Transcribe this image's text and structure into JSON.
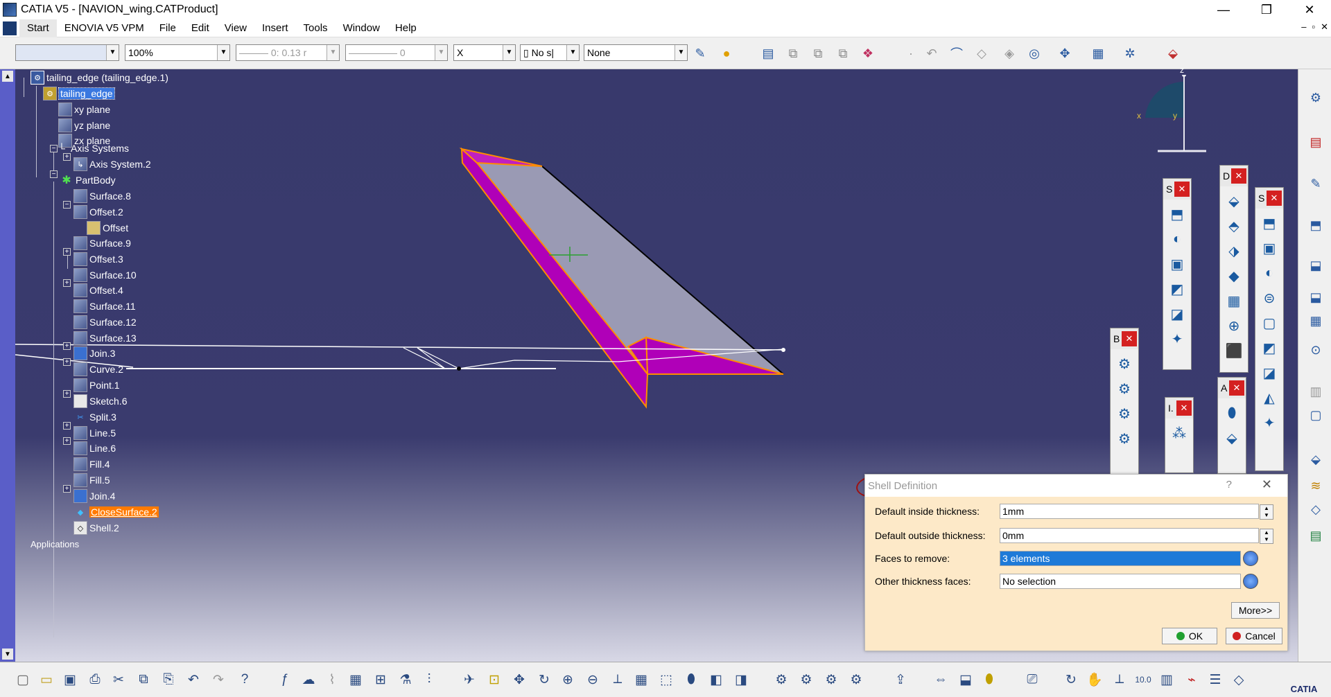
{
  "window": {
    "title": "CATIA V5 - [NAVION_wing.CATProduct]",
    "min": "—",
    "restore": "❐",
    "close": "✕",
    "mdi": [
      "‒",
      "▫",
      "✕"
    ]
  },
  "menu": [
    "Start",
    "ENOVIA V5 VPM",
    "File",
    "Edit",
    "View",
    "Insert",
    "Tools",
    "Window",
    "Help"
  ],
  "toolbar": {
    "color_combo": "",
    "zoom": "100%",
    "linetype": "0: 0.13 r",
    "lineweight": "0",
    "layer_sym": "X",
    "layer": "No s|",
    "style": "None"
  },
  "tree": {
    "root": "tailing_edge (tailing_edge.1)",
    "part": "tailing_edge",
    "nodes": [
      "xy plane",
      "yz plane",
      "zx plane",
      "Axis Systems",
      "Axis System.2",
      "PartBody",
      "Surface.8",
      "Offset.2",
      "Offset",
      "Surface.9",
      "Offset.3",
      "Surface.10",
      "Offset.4",
      "Surface.11",
      "Surface.12",
      "Surface.13",
      "Join.3",
      "Curve.2",
      "Point.1",
      "Sketch.6",
      "Split.3",
      "Line.5",
      "Line.6",
      "Fill.4",
      "Fill.5",
      "Join.4",
      "CloseSurface.2",
      "Shell.2"
    ],
    "applications": "Applications"
  },
  "compass": {
    "z": "z",
    "x": "x",
    "y": "y"
  },
  "floating_toolbars": {
    "t1": "S",
    "t2": "D",
    "t3": "S",
    "t4": "B",
    "t5": "I.",
    "t6": "A"
  },
  "dialog": {
    "title": "Shell Definition",
    "help": "?",
    "close": "✕",
    "inside_label": "Default inside thickness:",
    "inside_value": "1mm",
    "outside_label": "Default outside thickness:",
    "outside_value": "0mm",
    "faces_label": "Faces to remove:",
    "faces_value": "3 elements",
    "other_label": "Other thickness faces:",
    "other_value": "No selection",
    "more": "More>>",
    "ok": "OK",
    "cancel": "Cancel"
  },
  "branding": "CATIA",
  "colors": {
    "viewport": "#38396c",
    "selection": "#ff8c00",
    "solid": "#b000b8",
    "dialog_bg": "#fde9c8"
  }
}
